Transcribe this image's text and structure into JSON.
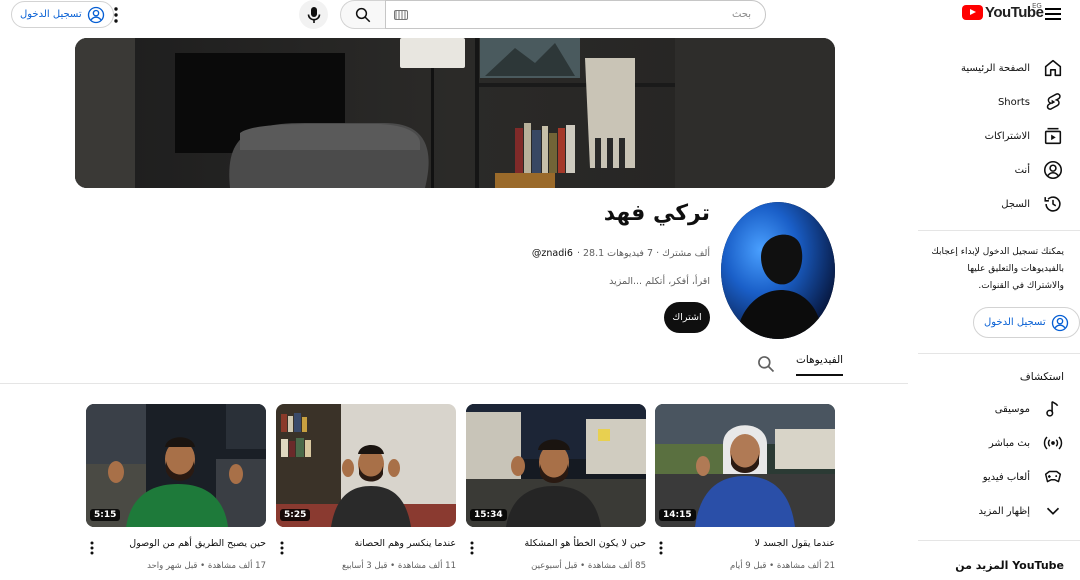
{
  "header": {
    "signin_label": "تسجيل الدخول",
    "search_placeholder": "بحث",
    "logo_text": "YouTube",
    "country_code": "EG",
    "brand_color": "#ff0000"
  },
  "sidebar": {
    "items": [
      {
        "label": "الصفحة الرئيسية",
        "icon": "home-icon"
      },
      {
        "label": "Shorts",
        "icon": "shorts-icon"
      },
      {
        "label": "الاشتراكات",
        "icon": "subscriptions-icon"
      },
      {
        "label": "أنت",
        "icon": "you-icon"
      },
      {
        "label": "السجل",
        "icon": "history-icon"
      }
    ],
    "signin_note": "يمكنك تسجيل الدخول لإبداء إعجابك بالفيديوهات والتعليق عليها والاشتراك في القنوات.",
    "signin_label": "تسجيل الدخول",
    "explore_heading": "استكشاف",
    "explore_items": [
      {
        "label": "موسيقى",
        "icon": "music-icon"
      },
      {
        "label": "بث مباشر",
        "icon": "live-icon"
      },
      {
        "label": "ألعاب فيديو",
        "icon": "gaming-icon"
      },
      {
        "label": "إظهار المزيد",
        "icon": "chevron-down-icon"
      }
    ],
    "more_heading": "المزيد من YouTube"
  },
  "channel": {
    "name": "تركي فهد",
    "handle": "@znadi6",
    "stats": "· 28.1 ألف مشترك · 7 فيديوهات",
    "description": "اقرأ، أفكر، أتكلم ...المزيد",
    "subscribe_label": "اشتراك"
  },
  "tabs": {
    "videos_label": "الفيديوهات"
  },
  "videos": [
    {
      "title": "عندما يقول الجسد لا",
      "meta": "21 ألف مشاهدة • قبل 9 أيام",
      "duration": "14:15"
    },
    {
      "title": "حين لا يكون الخطأ هو المشكلة",
      "meta": "85 ألف مشاهدة • قبل أسبوعين",
      "duration": "15:34"
    },
    {
      "title": "عندما ينكسر وهم الحصانة",
      "meta": "11 ألف مشاهدة • قبل 3 أسابيع",
      "duration": "5:25"
    },
    {
      "title": "حين يصبح الطريق أهم من الوصول",
      "meta": "17 ألف مشاهدة • قبل شهر واحد",
      "duration": "5:15"
    }
  ]
}
